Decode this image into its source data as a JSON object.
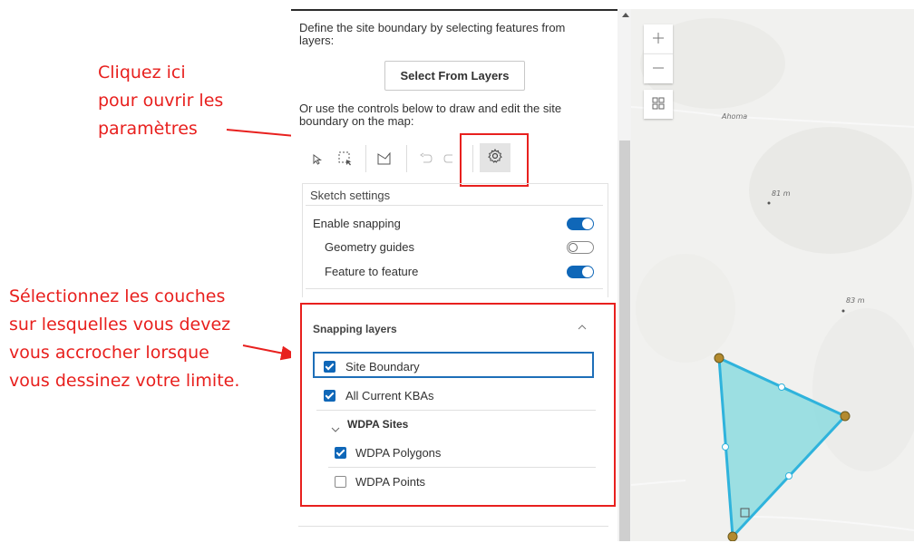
{
  "annotations": {
    "settings_callout": [
      "Cliquez ici",
      "pour ouvrir les",
      "paramètres"
    ],
    "snapping_callout": [
      "Sélectionnez les couches",
      "sur lesquelles vous devez",
      "vous accrocher lorsque",
      "vous dessinez votre limite."
    ],
    "color": "#e8201e"
  },
  "panel": {
    "intro_text_1": "Define the site boundary by selecting features from",
    "intro_text_2": "layers:",
    "select_button": "Select From Layers",
    "draw_text_1": "Or use the controls below to draw and edit the site",
    "draw_text_2": "boundary on the map:",
    "toolbar": {
      "tools": [
        "select-arrow-icon",
        "rectangle-select-icon",
        "polygon-icon",
        "undo-icon",
        "redo-icon",
        "gear-icon"
      ]
    },
    "sketch_settings": {
      "title": "Sketch settings",
      "rows": [
        {
          "label": "Enable snapping",
          "on": true
        },
        {
          "label": "Geometry guides",
          "on": false
        },
        {
          "label": "Feature to feature",
          "on": true
        }
      ]
    },
    "snapping_layers": {
      "title": "Snapping layers",
      "items": [
        {
          "label": "Site Boundary",
          "checked": true
        },
        {
          "label": "All Current KBAs",
          "checked": true
        }
      ],
      "group": {
        "label": "WDPA Sites",
        "items": [
          {
            "label": "WDPA Polygons",
            "checked": true
          },
          {
            "label": "WDPA Points",
            "checked": false
          }
        ]
      }
    }
  },
  "map": {
    "place_label": "Ahoma",
    "elevation_labels": [
      "81 m",
      "83 m"
    ],
    "controls": [
      "zoom-in-icon",
      "zoom-out-icon",
      "basemap-gallery-icon"
    ],
    "polygon_fill": "#8ddcdf",
    "polygon_stroke": "#2fb3dc",
    "vertex_color": "#b38a2e"
  },
  "accent": "#0f67b8"
}
